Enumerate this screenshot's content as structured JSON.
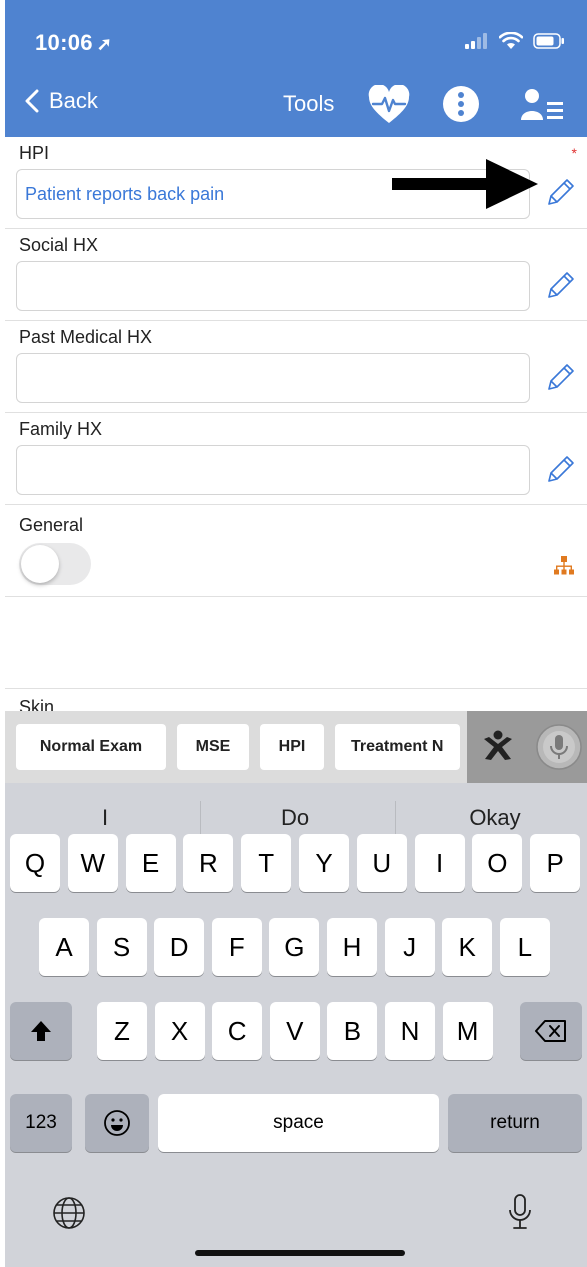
{
  "status": {
    "time": "10:06"
  },
  "nav": {
    "back_label": "Back",
    "tools_label": "Tools"
  },
  "form": {
    "fields": [
      {
        "label": "HPI",
        "value": "Patient reports back pain",
        "required_mark": "*"
      },
      {
        "label": "Social HX",
        "value": ""
      },
      {
        "label": "Past Medical HX",
        "value": ""
      },
      {
        "label": "Family HX",
        "value": ""
      }
    ],
    "general": {
      "label": "General",
      "toggle_on": false
    },
    "next_section": {
      "label": "Skin"
    }
  },
  "quick_bar": {
    "buttons": [
      "Normal Exam",
      "MSE",
      "HPI",
      "Treatment N"
    ]
  },
  "keyboard": {
    "suggestions": [
      "I",
      "Do",
      "Okay"
    ],
    "row1": [
      "Q",
      "W",
      "E",
      "R",
      "T",
      "Y",
      "U",
      "I",
      "O",
      "P"
    ],
    "row2": [
      "A",
      "S",
      "D",
      "F",
      "G",
      "H",
      "J",
      "K",
      "L"
    ],
    "row3": [
      "Z",
      "X",
      "C",
      "V",
      "B",
      "N",
      "M"
    ],
    "numbers_label": "123",
    "space_label": "space",
    "return_label": "return"
  },
  "colors": {
    "nav_bar": "#4f83d0",
    "link_text": "#3a78d8",
    "required": "#e03030",
    "tree_icon": "#e07a20"
  }
}
